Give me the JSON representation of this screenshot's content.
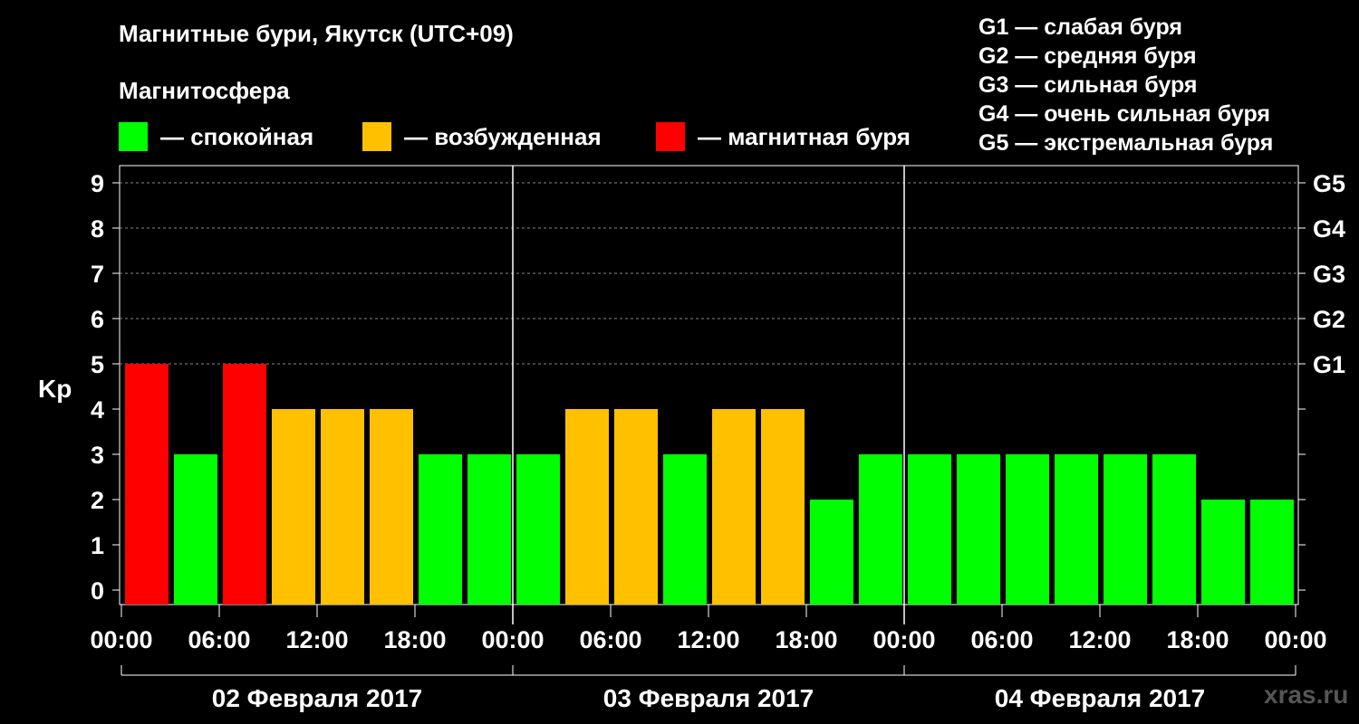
{
  "title": "Магнитные бури, Якутск (UTC+09)",
  "subtitle": "Магнитосфера",
  "legend": [
    {
      "color": "#00ff00",
      "label": "— спокойная"
    },
    {
      "color": "#ffc000",
      "label": "— возбужденная"
    },
    {
      "color": "#ff0000",
      "label": "— магнитная буря"
    }
  ],
  "g_legend": [
    "G1 — слабая буря",
    "G2 — средняя буря",
    "G3 — сильная буря",
    "G4 — очень сильная буря",
    "G5 — экстремальная буря"
  ],
  "watermark": "xras.ru",
  "chart_data": {
    "type": "bar",
    "ylabel": "Kp",
    "ylim": [
      0,
      9
    ],
    "y_ticks": [
      "0",
      "1",
      "2",
      "3",
      "4",
      "5",
      "6",
      "7",
      "8",
      "9"
    ],
    "right_ticks": [
      {
        "value": 5,
        "label": "G1"
      },
      {
        "value": 6,
        "label": "G2"
      },
      {
        "value": 7,
        "label": "G3"
      },
      {
        "value": 8,
        "label": "G4"
      },
      {
        "value": 9,
        "label": "G5"
      }
    ],
    "x_tick_labels": [
      "00:00",
      "06:00",
      "12:00",
      "18:00",
      "00:00",
      "06:00",
      "12:00",
      "18:00",
      "00:00",
      "06:00",
      "12:00",
      "18:00",
      "00:00"
    ],
    "days": [
      "02 Февраля 2017",
      "03 Февраля 2017",
      "04 Февраля 2017"
    ],
    "grid": true,
    "colors": {
      "calm": "#00ff00",
      "active": "#ffc000",
      "storm": "#ff0000"
    },
    "values": [
      5,
      3,
      5,
      4,
      4,
      4,
      3,
      3,
      3,
      4,
      4,
      3,
      4,
      4,
      2,
      3,
      3,
      3,
      3,
      3,
      3,
      3,
      2,
      2
    ]
  }
}
